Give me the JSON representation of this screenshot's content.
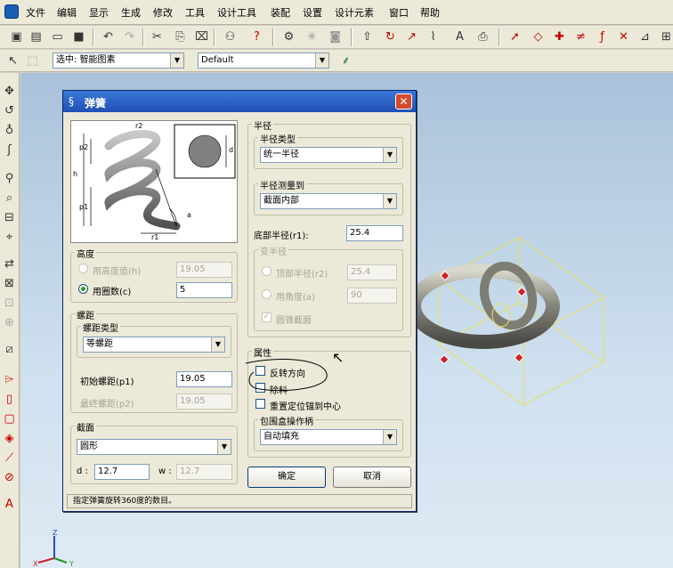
{
  "menu": [
    "文件",
    "编辑",
    "显示",
    "生成",
    "修改",
    "工具",
    "设计工具",
    "装配",
    "设置",
    "设计元素",
    "窗口",
    "帮助"
  ],
  "toolbar2": {
    "selection_combo": "选中: 智能图素",
    "style_combo": "Default"
  },
  "dialog": {
    "title": "弹簧",
    "preview_labels": {
      "h": "h",
      "p1": "p1",
      "p2": "p2",
      "r1": "r1",
      "r2": "r2",
      "a": "a",
      "d": "d"
    },
    "height_group": {
      "title": "高度",
      "opt_height": "用高度值(h)",
      "height_value": "19.05",
      "opt_turns": "用圈数(c)",
      "turns_value": "5"
    },
    "pitch_group": {
      "title": "螺距",
      "type_label": "螺距类型",
      "type_value": "等螺距",
      "initial_label": "初始螺距(p1)",
      "initial_value": "19.05",
      "final_label": "最终螺距(p2)",
      "final_value": "19.05"
    },
    "section_group": {
      "title": "截面",
      "shape_value": "圆形",
      "d_label": "d :",
      "d_value": "12.7",
      "w_label": "w :",
      "w_value": "12.7"
    },
    "radius_group": {
      "title": "半径",
      "type_label": "半径类型",
      "type_value": "统一半径",
      "measure_label": "半径测量到",
      "measure_value": "截面内部",
      "bottom_label": "底部半径(r1):",
      "bottom_value": "25.4",
      "var_title": "变半径",
      "top_label": "顶部半径(r2)",
      "top_value": "25.4",
      "angle_label": "用角度(a)",
      "angle_value": "90",
      "round_label": "圆锥截面"
    },
    "props_group": {
      "title": "属性",
      "reverse_label": "反转方向",
      "remove_label": "除料",
      "recenter_label": "重置定位锚到中心",
      "wrap_label": "包围盒操作柄",
      "wrap_value": "自动填充"
    },
    "ok": "确定",
    "cancel": "取消",
    "status": "指定弹簧旋转360度的数目。"
  },
  "axes": {
    "x": "X",
    "y": "Y",
    "z": "Z"
  },
  "colors": {
    "title_bg": "#2f62c8",
    "canvas_top": "#a9c2da",
    "accent_green": "#21a121"
  }
}
